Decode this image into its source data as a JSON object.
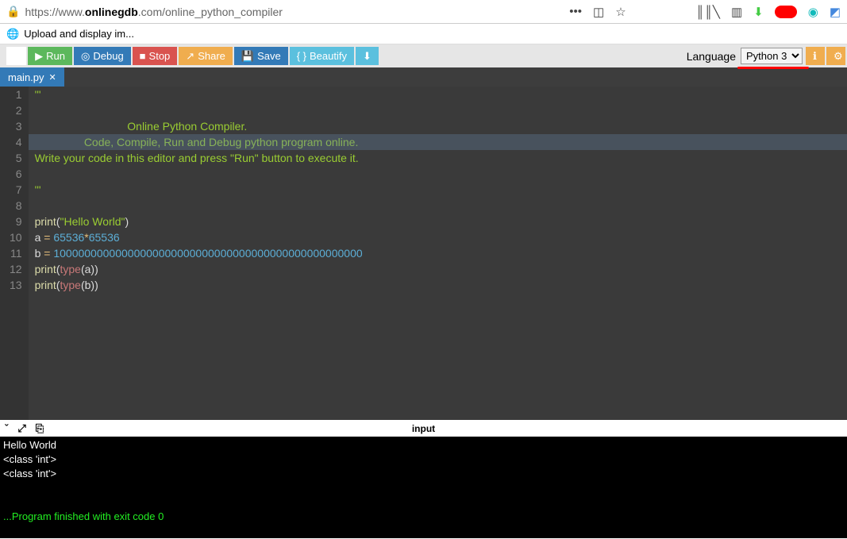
{
  "browser": {
    "url_prefix": "https://www.",
    "url_domain": "onlinegdb",
    "url_suffix": ".com/online_python_compiler",
    "favtab_label": "Upload and display im..."
  },
  "toolbar": {
    "run": "Run",
    "debug": "Debug",
    "stop": "Stop",
    "share": "Share",
    "save": "Save",
    "beautify": "Beautify",
    "language_label": "Language",
    "language_selected": "Python 3"
  },
  "tabs": {
    "active": "main.py"
  },
  "code": {
    "lines": [
      [
        [
          "'''",
          "comment"
        ]
      ],
      [
        [
          "",
          ""
        ]
      ],
      [
        [
          "                              Online Python Compiler.",
          "comment"
        ]
      ],
      [
        [
          "                Code, Compile, Run and Debug python program online.",
          "comment"
        ]
      ],
      [
        [
          "Write your code in this editor and press \"Run\" button to execute it.",
          "comment"
        ]
      ],
      [
        [
          "",
          ""
        ]
      ],
      [
        [
          "'''",
          "comment"
        ]
      ],
      [
        [
          "",
          ""
        ]
      ],
      [
        [
          "print",
          "fn"
        ],
        [
          "(",
          ""
        ],
        [
          "\"Hello World\"",
          "str"
        ],
        [
          ")",
          ""
        ]
      ],
      [
        [
          "a ",
          ""
        ],
        [
          "=",
          "op"
        ],
        [
          " ",
          ""
        ],
        [
          "65536",
          "num"
        ],
        [
          "*",
          "op"
        ],
        [
          "65536",
          "num"
        ]
      ],
      [
        [
          "b ",
          ""
        ],
        [
          "=",
          "op"
        ],
        [
          " ",
          ""
        ],
        [
          "10000000000000000000000000000000000000000000000000",
          "num"
        ]
      ],
      [
        [
          "print",
          "fn"
        ],
        [
          "(",
          ""
        ],
        [
          "type",
          "type"
        ],
        [
          "(a))",
          ""
        ]
      ],
      [
        [
          "print",
          "fn"
        ],
        [
          "(",
          ""
        ],
        [
          "type",
          "type"
        ],
        [
          "(b))",
          ""
        ]
      ]
    ]
  },
  "console": {
    "input_tab": "input",
    "lines": [
      [
        "Hello World",
        "plain"
      ],
      [
        "<class 'int'>",
        "plain"
      ],
      [
        "<class 'int'>",
        "plain"
      ],
      [
        "",
        "plain"
      ],
      [
        "",
        "plain"
      ],
      [
        "...Program finished with exit code 0",
        "exit"
      ]
    ]
  }
}
